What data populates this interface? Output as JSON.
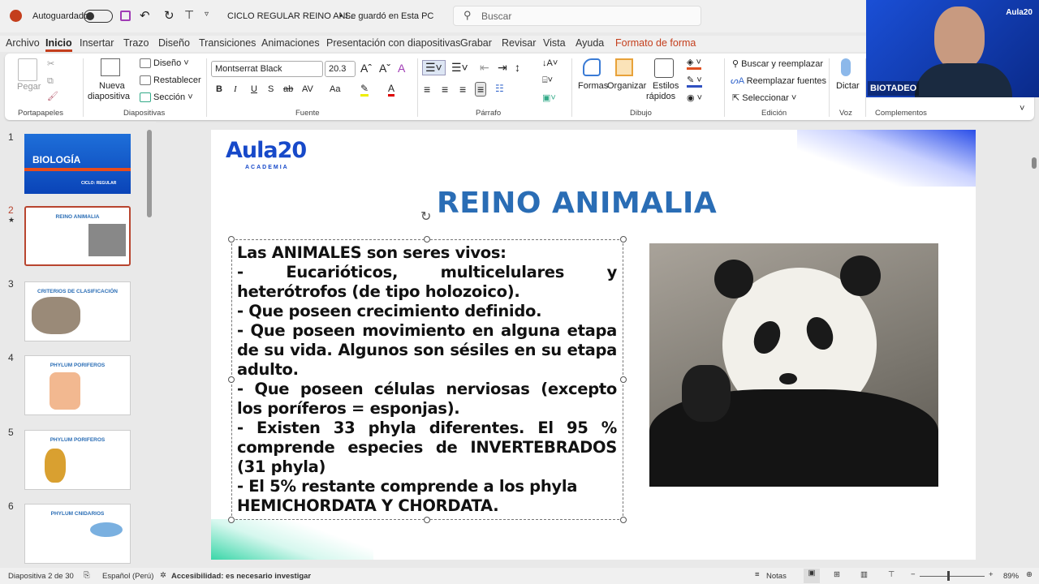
{
  "titlebar": {
    "autosave_label": "Autoguardado",
    "doc_title": "CICLO REGULAR REINO ANI...",
    "save_status": "• Se guardó en Esta PC",
    "search_placeholder": "Buscar"
  },
  "tabs": [
    "Archivo",
    "Inicio",
    "Insertar",
    "Trazo",
    "Diseño",
    "Transiciones",
    "Animaciones",
    "Presentación con diapositivas",
    "Grabar",
    "Revisar",
    "Vista",
    "Ayuda",
    "Formato de forma"
  ],
  "ribbon": {
    "portapapeles": {
      "paste": "Pegar",
      "group": "Portapapeles"
    },
    "diapositivas": {
      "new_slide_1": "Nueva",
      "new_slide_2": "diapositiva",
      "layout": "Diseño",
      "reset": "Restablecer",
      "section": "Sección",
      "group": "Diapositivas"
    },
    "fuente": {
      "font": "Montserrat Black",
      "size": "20.3",
      "bold": "B",
      "italic": "I",
      "underline": "U",
      "shadow": "S",
      "strike": "ab",
      "spacing": "AV",
      "case": "Aa",
      "group": "Fuente"
    },
    "parrafo": {
      "group": "Párrafo"
    },
    "dibujo": {
      "shapes": "Formas",
      "arrange": "Organizar",
      "styles_1": "Estilos",
      "styles_2": "rápidos",
      "group": "Dibujo"
    },
    "edicion": {
      "find": "Buscar y reemplazar",
      "replace_fonts": "Reemplazar fuentes",
      "select": "Seleccionar",
      "group": "Edición"
    },
    "voz": {
      "dictate": "Dictar",
      "group": "Voz"
    },
    "complementos": {
      "group": "Complementos"
    }
  },
  "webcam": {
    "name": "BIOTADEO",
    "logo": "Aula20"
  },
  "slides": [
    {
      "num": "1",
      "title": "BIOLOGÍA",
      "subtitle": "CICLO: REGULAR"
    },
    {
      "num": "2",
      "title": "REINO ANIMALIA"
    },
    {
      "num": "3",
      "title": "CRITERIOS DE CLASIFICACIÓN"
    },
    {
      "num": "4",
      "title": "PHYLUM PORIFEROS"
    },
    {
      "num": "5",
      "title": "PHYLUM PORIFEROS"
    },
    {
      "num": "6",
      "title": "PHYLUM CNIDARIOS"
    }
  ],
  "slide": {
    "logo": "Aula20",
    "logo_sub": "ACADEMIA",
    "title": "REINO ANIMALIA",
    "lines": [
      "Las ANIMALES son seres vivos:",
      "- Eucarióticos, multicelulares y",
      "heterótrofos (de tipo holozoico).",
      "- Que poseen crecimiento definido.",
      "- Que poseen movimiento en alguna etapa",
      "de su vida. Algunos son sésiles en su etapa",
      "adulto.",
      "- Que poseen células nerviosas (excepto",
      "los poríferos = esponjas).",
      "- Existen 33 phyla diferentes. El 95 %",
      "comprende especies de INVERTEBRADOS",
      "(31 phyla)",
      "- El 5% restante comprende a los phyla",
      "HEMICHORDATA Y CHORDATA."
    ],
    "title_color": "#2a6db5"
  },
  "status": {
    "slide_of": "Diapositiva 2 de 30",
    "language": "Español (Perú)",
    "accessibility": "Accesibilidad: es necesario investigar",
    "notes": "Notas",
    "zoom": "89%"
  }
}
